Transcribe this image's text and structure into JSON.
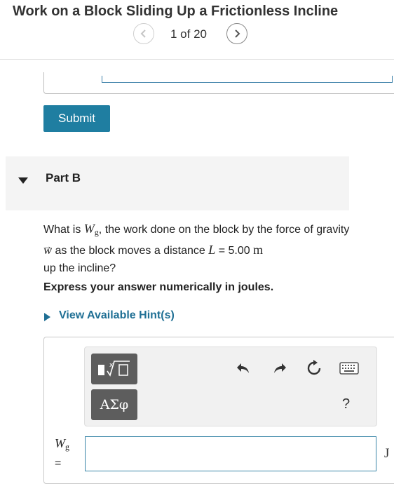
{
  "header": {
    "title": "Work on a Block Sliding Up a Frictionless Incline",
    "counter": "1 of 20"
  },
  "previous_part": {
    "submit_label": "Submit"
  },
  "part": {
    "label": "Part B"
  },
  "question": {
    "t1": "What is ",
    "w_symbol": "W",
    "w_sub": "g",
    "t2": ", the work done on the block by the force of gravity ",
    "vec_symbol": "w",
    "vec_arrow": "→",
    "t3": " as the block moves a distance ",
    "l_symbol": "L",
    "t4": " = 5.00 ",
    "unit_m": "m",
    "t5": " up the incline?"
  },
  "instruction": "Express your answer numerically in joules.",
  "hint_link": "View Available Hint(s)",
  "toolbar": {
    "greek_label": "ΑΣφ",
    "help_label": "?"
  },
  "answer": {
    "var_symbol": "W",
    "var_sub": "g",
    "equals": "=",
    "value": "",
    "unit": "J"
  },
  "icons": {
    "prev": "chevron-left-icon",
    "next": "chevron-right-icon",
    "undo": "undo-icon",
    "redo": "redo-icon",
    "reset": "reset-icon",
    "keyboard": "keyboard-icon",
    "templates": "templates-icon"
  },
  "colors": {
    "accent": "#1f7ea1",
    "link": "#1f6f94",
    "input_border": "#3a86a8",
    "toolbar_button": "#5d5d5d"
  }
}
